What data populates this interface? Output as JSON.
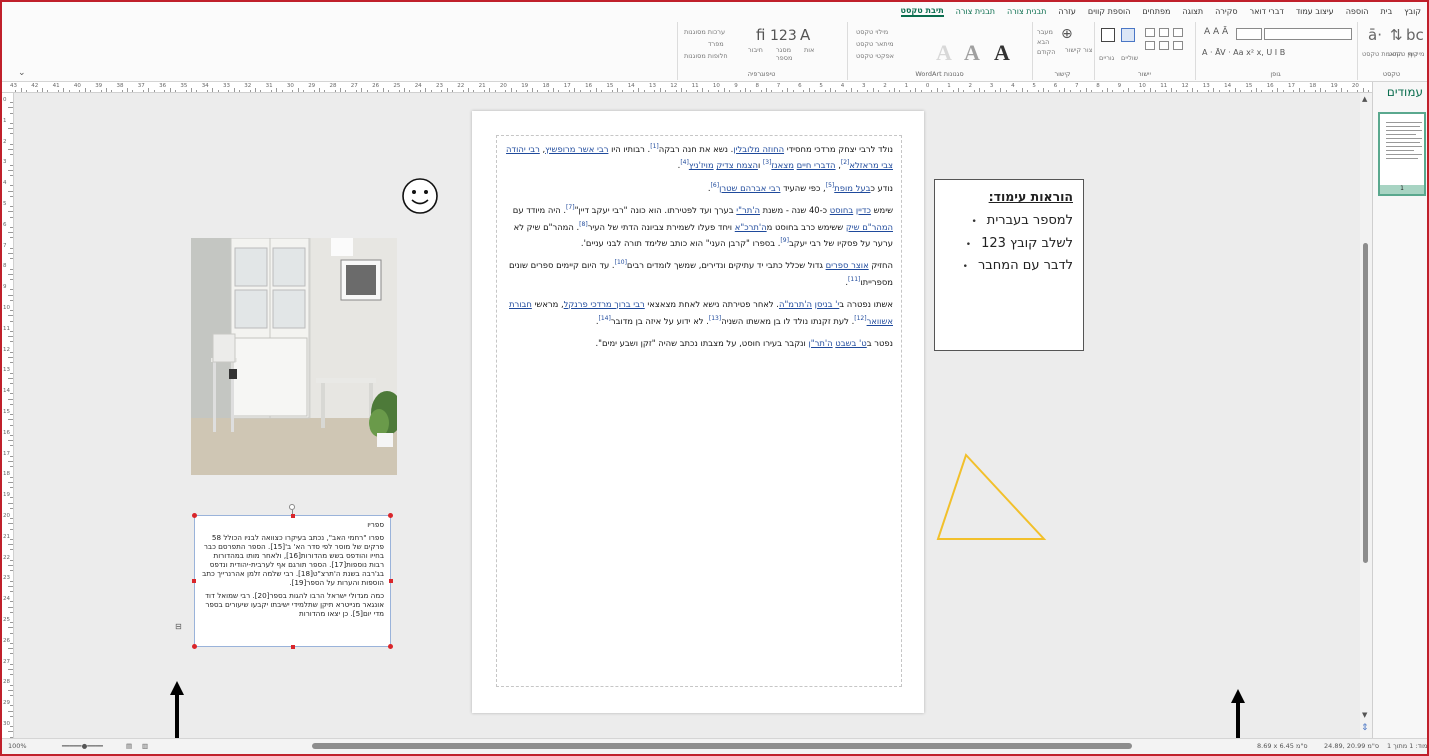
{
  "tabs": [
    {
      "label": "קובץ"
    },
    {
      "label": "בית"
    },
    {
      "label": "הוספה"
    },
    {
      "label": "עיצוב עמוד"
    },
    {
      "label": "דברי דואר"
    },
    {
      "label": "סקירה"
    },
    {
      "label": "תצוגה"
    },
    {
      "label": "מפתחים"
    },
    {
      "label": "הוספת קווים"
    },
    {
      "label": "עזרה"
    },
    {
      "label": "תבנית צורה"
    },
    {
      "label": "תבנית צורה"
    },
    {
      "label": "תיבת טקסט"
    }
  ],
  "ribbon": {
    "groups": {
      "text": "טקסט",
      "font": "גופן",
      "align": "יישור",
      "link": "קישור",
      "wordart": "WordArt סגנונות",
      "typography": "טיפוגרפיה"
    },
    "text_items": [
      "התאמת טקסט",
      "כיוון טקסט",
      "מיקוף"
    ],
    "align_items": [
      "גוריים",
      "שוליים"
    ],
    "link_items": [
      "מעבר",
      "הבא",
      "הקודם",
      "צור קישור"
    ],
    "wordart_items": [
      "מילוי טקסט",
      "מיתאר טקסט",
      "אפקטי טקסט"
    ],
    "typo_items": [
      "ערכות מסוגנות",
      "מפרד",
      "חלופות מסוגנות",
      "אות",
      "מסגר",
      "מספר",
      "חיבור"
    ],
    "font_size_glyph": "A",
    "numbers_glyph": "123"
  },
  "ruler_numbers": [
    "43",
    "42",
    "41",
    "40",
    "39",
    "38",
    "37",
    "36",
    "35",
    "34",
    "33",
    "32",
    "31",
    "30",
    "29",
    "28",
    "27",
    "26",
    "25",
    "24",
    "23",
    "22",
    "21",
    "20",
    "19",
    "18",
    "17",
    "16",
    "15",
    "14",
    "13",
    "12",
    "11",
    "10",
    "9",
    "8",
    "7",
    "6",
    "5",
    "4",
    "3",
    "2",
    "1",
    "0",
    "1",
    "2",
    "3",
    "4",
    "5",
    "6",
    "7",
    "8",
    "9",
    "10",
    "11",
    "12",
    "13",
    "14",
    "15",
    "16",
    "17",
    "18",
    "19",
    "20",
    "21",
    "22"
  ],
  "vruler_numbers": [
    "0",
    "1",
    "2",
    "3",
    "4",
    "5",
    "6",
    "7",
    "8",
    "9",
    "10",
    "11",
    "12",
    "13",
    "14",
    "15",
    "16",
    "17",
    "18",
    "19",
    "20",
    "21",
    "22",
    "23",
    "24",
    "25",
    "26",
    "27",
    "28",
    "29",
    "30"
  ],
  "article": {
    "p1": {
      "t1": "נולד לרבי יצחק מרדכי מחסידי ",
      "l1": "החוזה מלובלין",
      "t2": ". נשא את חנה רבקה",
      "r1": "[1]",
      "t3": ". רבותיו היו ",
      "l2": "רבי אשר מרופשיץ",
      "t4": ", ",
      "l3": "רבי יהודה צבי מראזלא",
      "r2": "[2]",
      "t5": ", ",
      "l4": "הדברי חיים",
      "t6": " ",
      "l5": "מצאנז",
      "r3": "[3]",
      "t7": " ו",
      "l6": "הצמח צדיק",
      "t8": " ",
      "l7": "מויז'ניץ",
      "r4": "[4]",
      "t9": "."
    },
    "p2": {
      "t1": "נודע כ",
      "l1": "בעל מופת",
      "r1": "[5]",
      "t2": ", כפי שהעיד ",
      "l2": "רבי אברהם שטרן",
      "r2": "[6]",
      "t3": "."
    },
    "p3": {
      "t1": "שימש ",
      "l1": "כדיין",
      "t2": " ",
      "l2": "בחוסט",
      "t3": " כ-40 שנה - משנת ",
      "l3": "ה'תר\"י",
      "t4": " בערך ועד לפטירתו. הוא כונה \"רבי יעקב דיין\"",
      "r1": "[7]",
      "t5": ". היה מיודד עם ",
      "l4": "המהר\"ם שיק",
      "t6": " ששימש כרב בחוסט מ",
      "l5": "ה'תרכ\"א",
      "t7": " ויחד פעלו לשמירת צביונה הדתי של העיר",
      "r2": "[8]",
      "t8": ". המהר\"ם שיק לא ערער על פסקיו של רבי יעקב",
      "r3": "[9]",
      "t9": ". בספרו \"קרבן העני\" הוא כותב שלימד תורה לבני עניים'."
    },
    "p4": {
      "t1": "החזיק ",
      "l1": "אוצר ספרים",
      "t2": " גדול שכלל כתבי יד עתיקים ונדירים, שמשך לומדים רבים",
      "r1": "[10]",
      "t3": ". עד היום קיימים ספרים שונים מספרייתו",
      "r2": "[11]",
      "t4": "."
    },
    "p5": {
      "t1": "אשתו נפטרה ב",
      "l1": "י' בניסן",
      "t2": " ",
      "l2": "ה'תרמ\"ה",
      "t3": ". לאחר פטירתה נישא לאחת מצאצאי ",
      "l3": "רבי ברוך מרדכי פרנקל",
      "t4": ", מראשי ",
      "l4": "חבורת אשוואר",
      "r1": "[12]",
      "t5": ". לעת זקנתו נולד לו בן מאשתו השניה",
      "r2": "[13]",
      "t6": ". לא ידוע על איזה בן מדובר",
      "r3": "[14]",
      "t7": "."
    },
    "p6": {
      "t1": "נפטר ב",
      "l1": "ט' בשבט",
      "t2": " ",
      "l2": "ה'תר\"ן",
      "t3": " ונקבר בעירו חוסט, על מצבתו נכתב שהיה \"זקן ושבע ימים\"."
    }
  },
  "instructions": {
    "title": "הוראות עימוד:",
    "items": [
      "למספר בעברית",
      "לשלב קובץ 123",
      "לדבר עם המחבר"
    ]
  },
  "footnote": {
    "title": "ספריו",
    "p1": "ספרו \"רחמי האב\", נכתב בעיקרו כצוואה לבניו הכולל 58 פרקים של מוסר לפי סדר הא' ב'[15]. הספר התפרסם כבר בחייו והודפס בשש מהדורות[16], ולאחר מותו במהדורות רבות נוספות[17]. הספר תורגם אף לערבית-יהודית ונדפס בג'רבה בשנת ה'תרצ\"ט[18]. רבי שלמה זלמן אהרנרייך כתב הוספות והערות על הספר[19].",
    "p2": "כמה מגדולי ישראל הרבו להגות בספר[20]. רבי שמואל דוד אונגאר מנייטרא תיקן שתלמידי ישיבתו יקבעו שיעורים בספר מדי יום[5]. כן יצאו מהדורות"
  },
  "pane": {
    "title": "עמודים",
    "page_number": "1"
  },
  "status": {
    "left": "100%",
    "right1": "8.69 x 6.45 ס\"מ",
    "right2": "24.89, 20.99 ס\"מ",
    "right3": "עמוד: 1 מתוך 1"
  },
  "colors": {
    "accent": "#0b6e4f",
    "link": "#1f4a9c",
    "triangle_stroke": "#f2c02b",
    "selection_handle": "#d9262b",
    "frame": "#c0202b"
  }
}
